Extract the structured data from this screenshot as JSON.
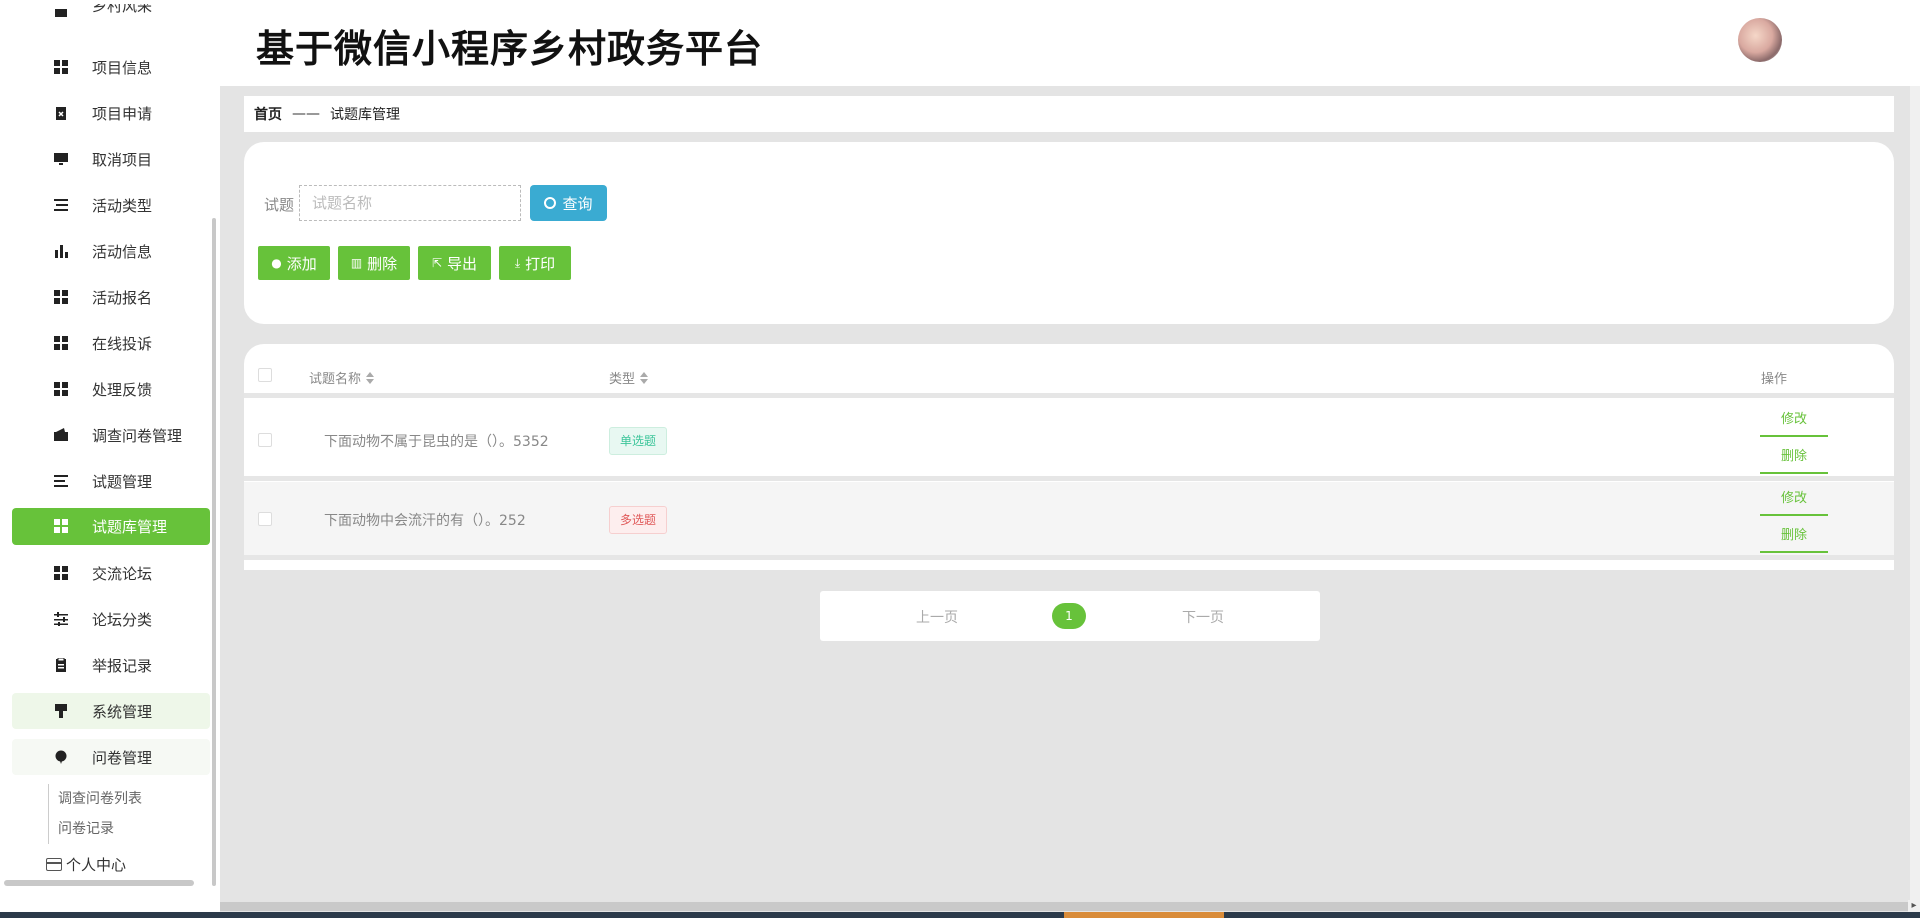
{
  "header": {
    "title": "基于微信小程序乡村政务平台"
  },
  "sidebar": {
    "cut_item": "乡村风采",
    "items": [
      {
        "label": "项目信息",
        "icon": "grid-icon"
      },
      {
        "label": "项目申请",
        "icon": "clipboard-x-icon"
      },
      {
        "label": "取消项目",
        "icon": "monitor-icon"
      },
      {
        "label": "活动类型",
        "icon": "list-icon"
      },
      {
        "label": "活动信息",
        "icon": "bar-chart-icon"
      },
      {
        "label": "活动报名",
        "icon": "grid-icon"
      },
      {
        "label": "在线投诉",
        "icon": "grid-icon"
      },
      {
        "label": "处理反馈",
        "icon": "grid-icon"
      },
      {
        "label": "调查问卷管理",
        "icon": "wallet-icon"
      },
      {
        "label": "试题管理",
        "icon": "list-icon"
      },
      {
        "label": "试题库管理",
        "icon": "grid-icon"
      },
      {
        "label": "交流论坛",
        "icon": "grid-icon"
      },
      {
        "label": "论坛分类",
        "icon": "sliders-icon"
      },
      {
        "label": "举报记录",
        "icon": "clipboard-icon"
      },
      {
        "label": "系统管理",
        "icon": "brush-icon"
      },
      {
        "label": "问卷管理",
        "icon": "balloon-icon"
      }
    ],
    "active_label": "试题库管理",
    "sub_items": [
      "调查问卷列表",
      "问卷记录"
    ],
    "personal": "个人中心"
  },
  "breadcrumb": {
    "home": "首页",
    "separator": "——",
    "current": "试题库管理"
  },
  "search": {
    "label": "试题",
    "placeholder": "试题名称",
    "query_label": "查询"
  },
  "toolbar": {
    "add": "添加",
    "delete": "删除",
    "export": "导出",
    "print": "打印"
  },
  "table": {
    "columns": {
      "name": "试题名称",
      "type": "类型",
      "action": "操作"
    },
    "rows": [
      {
        "name": "下面动物不属于昆虫的是（）。5352",
        "type": "单选题",
        "edit": "修改",
        "delete": "删除"
      },
      {
        "name": "下面动物中会流汗的有（）。252",
        "type": "多选题",
        "edit": "修改",
        "delete": "删除"
      }
    ]
  },
  "pagination": {
    "prev": "上一页",
    "current": "1",
    "next": "下一页"
  },
  "colors": {
    "accent": "#67c23a",
    "query": "#3aabd2",
    "single_tag": "#3cc59a",
    "multi_tag": "#e05a5a"
  }
}
